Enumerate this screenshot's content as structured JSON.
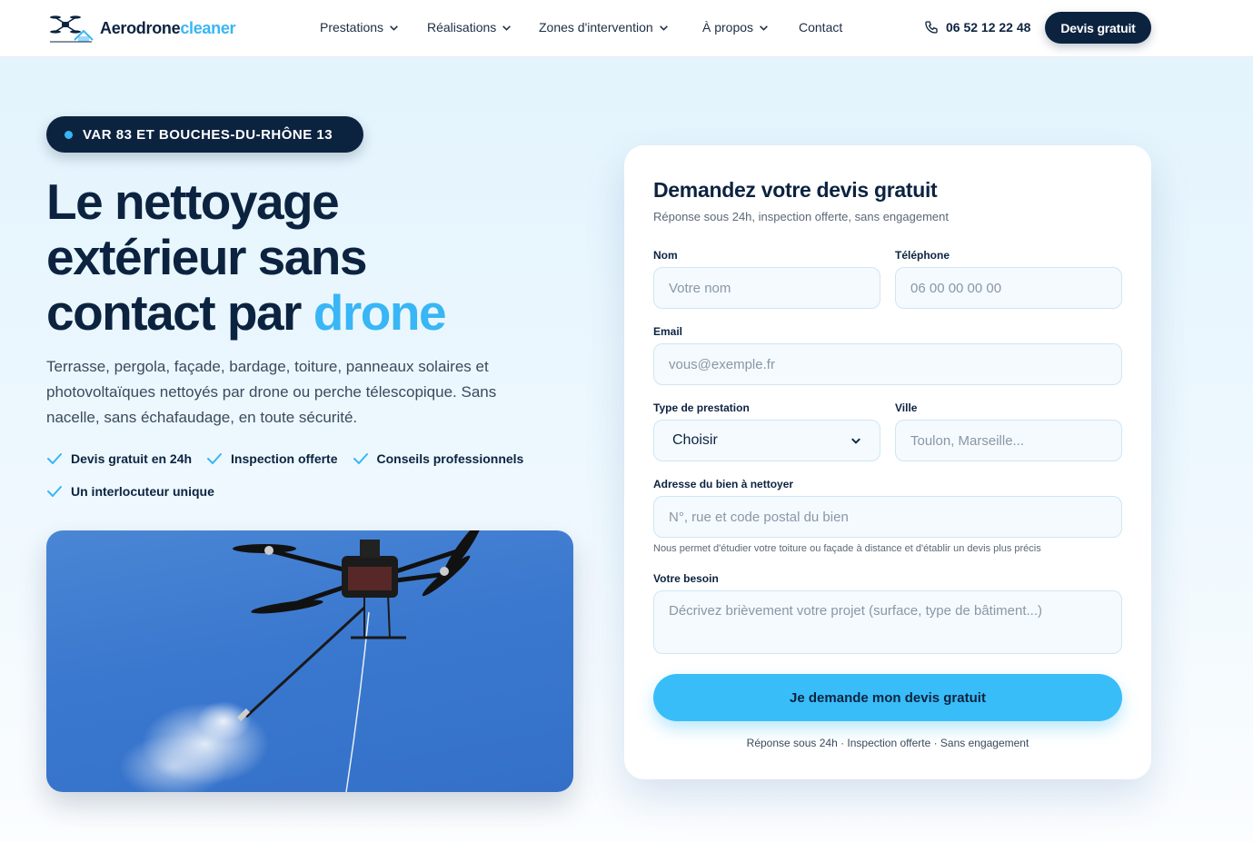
{
  "header": {
    "logo_main": "Aerodrone",
    "logo_accent": "cleaner",
    "nav": [
      {
        "label": "Prestations",
        "has_dropdown": true
      },
      {
        "label": "Réalisations",
        "has_dropdown": true
      },
      {
        "label": "Zones d'intervention",
        "has_dropdown": true
      },
      {
        "label": "À propos",
        "has_dropdown": true
      },
      {
        "label": "Contact",
        "has_dropdown": false
      }
    ],
    "phone": "06 52 12 22 48",
    "cta": "Devis gratuit"
  },
  "hero": {
    "badge": "VAR 83 ET BOUCHES-DU-RHÔNE 13",
    "title_line1": "Le nettoyage",
    "title_line2": "extérieur sans",
    "title_line3": "contact par ",
    "title_highlight": "drone",
    "lead": "Terrasse, pergola, façade, bardage, toiture, panneaux solaires et photovoltaïques nettoyés par drone ou perche télescopique. Sans nacelle, sans échafaudage, en toute sécurité.",
    "checks": [
      "Devis gratuit en 24h",
      "Inspection offerte",
      "Conseils professionnels",
      "Un interlocuteur unique"
    ]
  },
  "form": {
    "title": "Demandez votre devis gratuit",
    "subtitle": "Réponse sous 24h, inspection offerte, sans engagement",
    "nom_label": "Nom",
    "nom_placeholder": "Votre nom",
    "tel_label": "Téléphone",
    "tel_placeholder": "06 00 00 00 00",
    "email_label": "Email",
    "email_placeholder": "vous@exemple.fr",
    "type_label": "Type de prestation",
    "type_value": "Choisir",
    "ville_label": "Ville",
    "ville_placeholder": "Toulon, Marseille...",
    "adresse_label": "Adresse du bien à nettoyer",
    "adresse_placeholder": "N°, rue et code postal du bien",
    "adresse_help": "Nous permet d'étudier votre toiture ou façade à distance et d'établir un devis plus précis",
    "besoin_label": "Votre besoin",
    "besoin_placeholder": "Décrivez brièvement votre projet (surface, type de bâtiment...)",
    "submit": "Je demande mon devis gratuit",
    "footer": "Réponse sous 24h · Inspection offerte · Sans engagement"
  },
  "colors": {
    "navy": "#0c2340",
    "accent": "#38b6f5",
    "button": "#38bdf8"
  }
}
